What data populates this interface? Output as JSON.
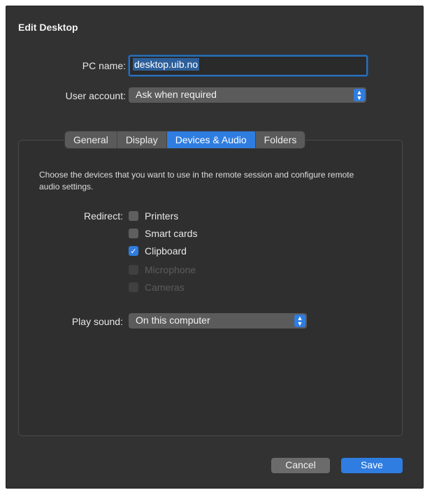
{
  "dialog": {
    "title": "Edit Desktop"
  },
  "form": {
    "pc_name_label": "PC name:",
    "pc_name_value": "desktop.uib.no",
    "user_account_label": "User account:",
    "user_account_value": "Ask when required"
  },
  "tabs": [
    {
      "label": "General",
      "active": false
    },
    {
      "label": "Display",
      "active": false
    },
    {
      "label": "Devices & Audio",
      "active": true
    },
    {
      "label": "Folders",
      "active": false
    }
  ],
  "devices": {
    "description": "Choose the devices that you want to use in the remote session and configure remote audio settings.",
    "redirect_label": "Redirect:",
    "options": [
      {
        "label": "Printers",
        "checked": false,
        "enabled": true
      },
      {
        "label": "Smart cards",
        "checked": false,
        "enabled": true
      },
      {
        "label": "Clipboard",
        "checked": true,
        "enabled": true
      },
      {
        "label": "Microphone",
        "checked": false,
        "enabled": false
      },
      {
        "label": "Cameras",
        "checked": false,
        "enabled": false
      }
    ],
    "play_sound_label": "Play sound:",
    "play_sound_value": "On this computer"
  },
  "buttons": {
    "cancel": "Cancel",
    "save": "Save"
  },
  "colors": {
    "accent": "#2f7de1",
    "window_bg": "#323232"
  },
  "icons": {
    "stepper": "chevron-updown-icon",
    "check": "checkmark-icon"
  }
}
